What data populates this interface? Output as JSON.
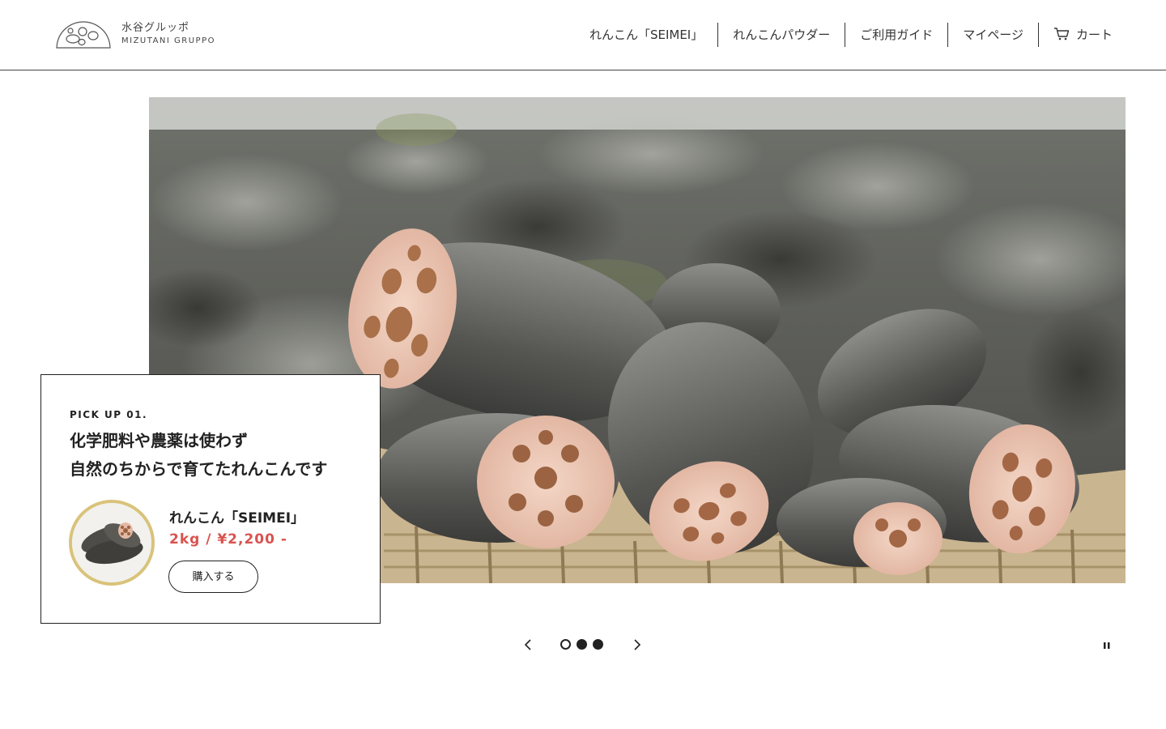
{
  "header": {
    "logo": {
      "ja": "水谷グルッポ",
      "en": "MIZUTANI GRUPPO"
    },
    "nav": [
      {
        "label": "れんこん「SEIMEI」"
      },
      {
        "label": "れんこんパウダー"
      },
      {
        "label": "ご利用ガイド"
      },
      {
        "label": "マイページ"
      },
      {
        "label": "カート",
        "icon": "cart-icon"
      }
    ]
  },
  "hero": {
    "image": "lotus-root-basket-photo",
    "slide_count": 3,
    "active_slide": 1
  },
  "pickup": {
    "eyebrow": "PICK UP 01.",
    "headline_line1": "化学肥料や農薬は使わず",
    "headline_line2": "自然のちからで育てたれんこんです",
    "product_name": "れんこん「SEIMEI」",
    "price": "2kg / ¥2,200 -",
    "buy_label": "購入する",
    "thumb_border_color": "#d9c37a",
    "price_color": "#d9534f"
  },
  "slider": {
    "prev_icon": "chevron-left-icon",
    "next_icon": "chevron-right-icon",
    "pause_icon": "pause-icon"
  }
}
